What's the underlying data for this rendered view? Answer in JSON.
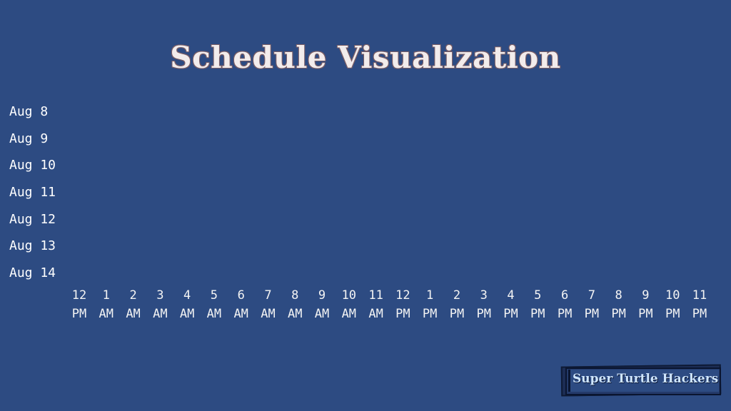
{
  "title": "Schedule Visualization",
  "days": [
    "Aug 8",
    "Aug 9",
    "Aug 10",
    "Aug 11",
    "Aug 12",
    "Aug 13",
    "Aug 14"
  ],
  "hours": [
    {
      "num": "12",
      "ampm": "PM"
    },
    {
      "num": "1",
      "ampm": "AM"
    },
    {
      "num": "2",
      "ampm": "AM"
    },
    {
      "num": "3",
      "ampm": "AM"
    },
    {
      "num": "4",
      "ampm": "AM"
    },
    {
      "num": "5",
      "ampm": "AM"
    },
    {
      "num": "6",
      "ampm": "AM"
    },
    {
      "num": "7",
      "ampm": "AM"
    },
    {
      "num": "8",
      "ampm": "AM"
    },
    {
      "num": "9",
      "ampm": "AM"
    },
    {
      "num": "10",
      "ampm": "AM"
    },
    {
      "num": "11",
      "ampm": "AM"
    },
    {
      "num": "12",
      "ampm": "PM"
    },
    {
      "num": "1",
      "ampm": "PM"
    },
    {
      "num": "2",
      "ampm": "PM"
    },
    {
      "num": "3",
      "ampm": "PM"
    },
    {
      "num": "4",
      "ampm": "PM"
    },
    {
      "num": "5",
      "ampm": "PM"
    },
    {
      "num": "6",
      "ampm": "PM"
    },
    {
      "num": "7",
      "ampm": "PM"
    },
    {
      "num": "8",
      "ampm": "PM"
    },
    {
      "num": "9",
      "ampm": "PM"
    },
    {
      "num": "10",
      "ampm": "PM"
    },
    {
      "num": "11",
      "ampm": "PM"
    }
  ],
  "branding": {
    "logo_text": "Super Turtle Hackers"
  },
  "colors": {
    "background": "#2d4b82",
    "title": "#f2ecec",
    "text": "#ffffff",
    "logo_text": "#cfe6ff"
  }
}
